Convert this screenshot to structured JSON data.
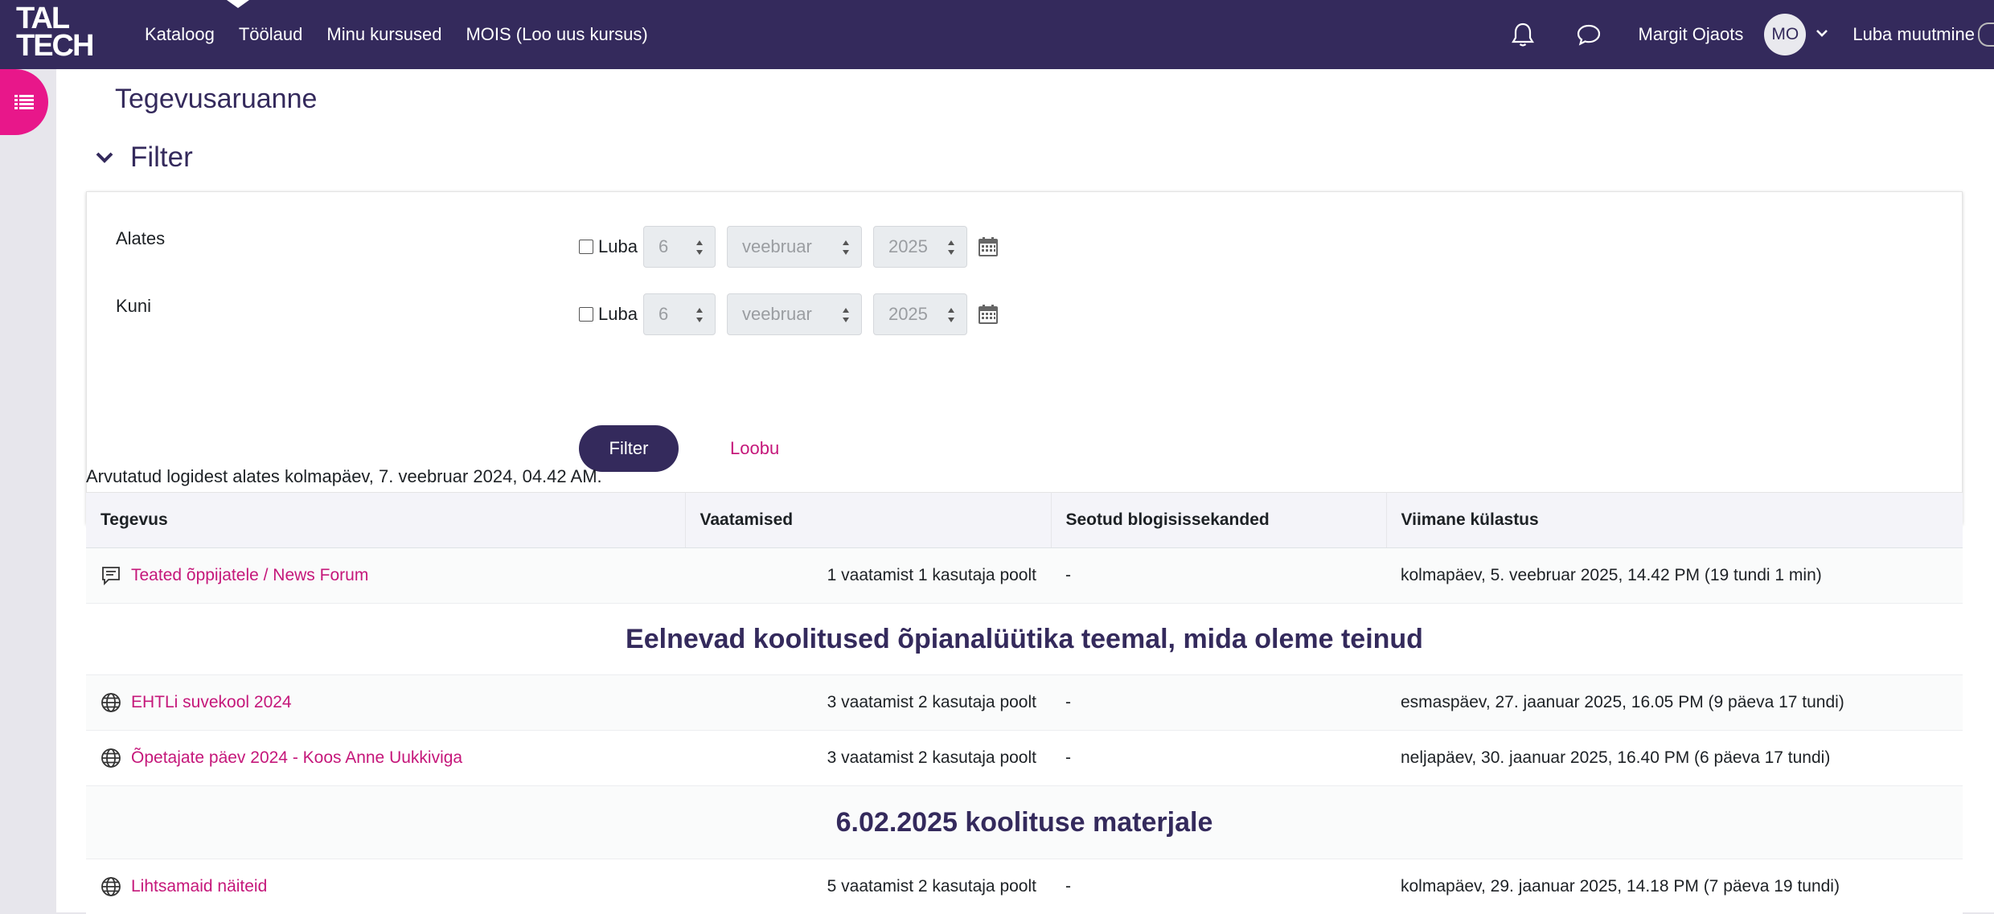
{
  "navbar": {
    "logo": [
      "TAL",
      "TECH"
    ],
    "links": [
      "Kataloog",
      "Töölaud",
      "Minu kursused",
      "MOIS (Loo uus kursus)"
    ],
    "username": "Margit Ojaots",
    "avatar_initials": "MO",
    "edit_mode_label": "Luba muutmine"
  },
  "page": {
    "title": "Tegevusaruanne",
    "filter_heading": "Filter"
  },
  "filter": {
    "from": {
      "label": "Alates",
      "enable_label": "Luba",
      "day": "6",
      "month": "veebruar",
      "year": "2025"
    },
    "to": {
      "label": "Kuni",
      "enable_label": "Luba",
      "day": "6",
      "month": "veebruar",
      "year": "2025"
    },
    "submit_label": "Filter",
    "cancel_label": "Loobu"
  },
  "report": {
    "computed_note": "Arvutatud logidest alates kolmapäev, 7. veebruar 2024, 04.42 AM.",
    "columns": [
      "Tegevus",
      "Vaatamised",
      "Seotud blogisissekanded",
      "Viimane külastus"
    ],
    "rows": [
      {
        "type": "activity",
        "icon": "forum-icon",
        "name": "Teated õppijatele / News Forum",
        "views": "1 vaatamist 1 kasutaja poolt",
        "blogs": "-",
        "last": "kolmapäev, 5. veebruar 2025, 14.42 PM (19 tundi 1 min)"
      },
      {
        "type": "section",
        "name": "Eelnevad koolitused õpianalüütika teemal, mida oleme teinud"
      },
      {
        "type": "activity",
        "icon": "globe-icon",
        "name": "EHTLi suvekool 2024",
        "views": "3 vaatamist 2 kasutaja poolt",
        "blogs": "-",
        "last": "esmaspäev, 27. jaanuar 2025, 16.05 PM (9 päeva 17 tundi)"
      },
      {
        "type": "activity",
        "icon": "globe-icon",
        "name": "Õpetajate päev 2024 - Koos Anne Uukkiviga",
        "views": "3 vaatamist 2 kasutaja poolt",
        "blogs": "-",
        "last": "neljapäev, 30. jaanuar 2025, 16.40 PM (6 päeva 17 tundi)"
      },
      {
        "type": "section",
        "name": "6.02.2025 koolituse materjale"
      },
      {
        "type": "activity",
        "icon": "globe-icon",
        "name": "Lihtsamaid näiteid",
        "views": "5 vaatamist 2 kasutaja poolt",
        "blogs": "-",
        "last": "kolmapäev, 29. jaanuar 2025, 14.18 PM (7 päeva 19 tundi)"
      }
    ]
  },
  "colors": {
    "brand": "#342a5c",
    "accent": "#e8178a",
    "link": "#c5177a"
  }
}
